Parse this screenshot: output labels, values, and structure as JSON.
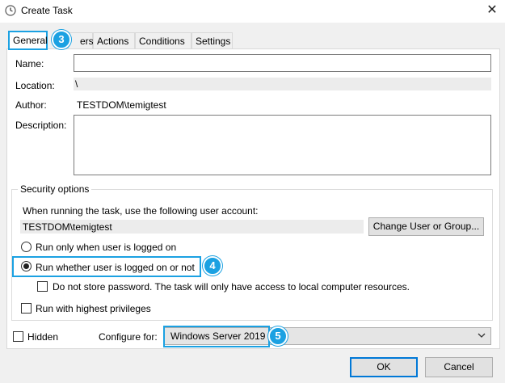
{
  "window": {
    "title": "Create Task",
    "close_glyph": "✕"
  },
  "tabs": [
    {
      "label": "General",
      "active": true
    },
    {
      "label": "ers",
      "active": false
    },
    {
      "label": "Actions",
      "active": false
    },
    {
      "label": "Conditions",
      "active": false
    },
    {
      "label": "Settings",
      "active": false
    }
  ],
  "general": {
    "name_label": "Name:",
    "name_value": "",
    "location_label": "Location:",
    "location_value": "\\",
    "author_label": "Author:",
    "author_value": "TESTDOM\\temigtest",
    "description_label": "Description:",
    "description_value": ""
  },
  "security": {
    "group_title": "Security options",
    "account_prompt": "When running the task, use the following user account:",
    "account_value": "TESTDOM\\temigtest",
    "change_button": "Change User or Group...",
    "radio_logged_on": "Run only when user is logged on",
    "radio_whether": "Run whether user is logged on or not",
    "selected_radio": "whether",
    "no_store_password": "Do not store password.  The task will only have access to local computer resources.",
    "highest_privileges": "Run with highest privileges"
  },
  "footer": {
    "hidden_label": "Hidden",
    "configure_label": "Configure for:",
    "configure_value": "Windows Server 2019",
    "ok_button": "OK",
    "cancel_button": "Cancel"
  },
  "annotations": {
    "badge_3": "3",
    "badge_4": "4",
    "badge_5": "5"
  },
  "colors": {
    "highlight": "#1ba1e2",
    "focus_blue": "#0078d7"
  }
}
